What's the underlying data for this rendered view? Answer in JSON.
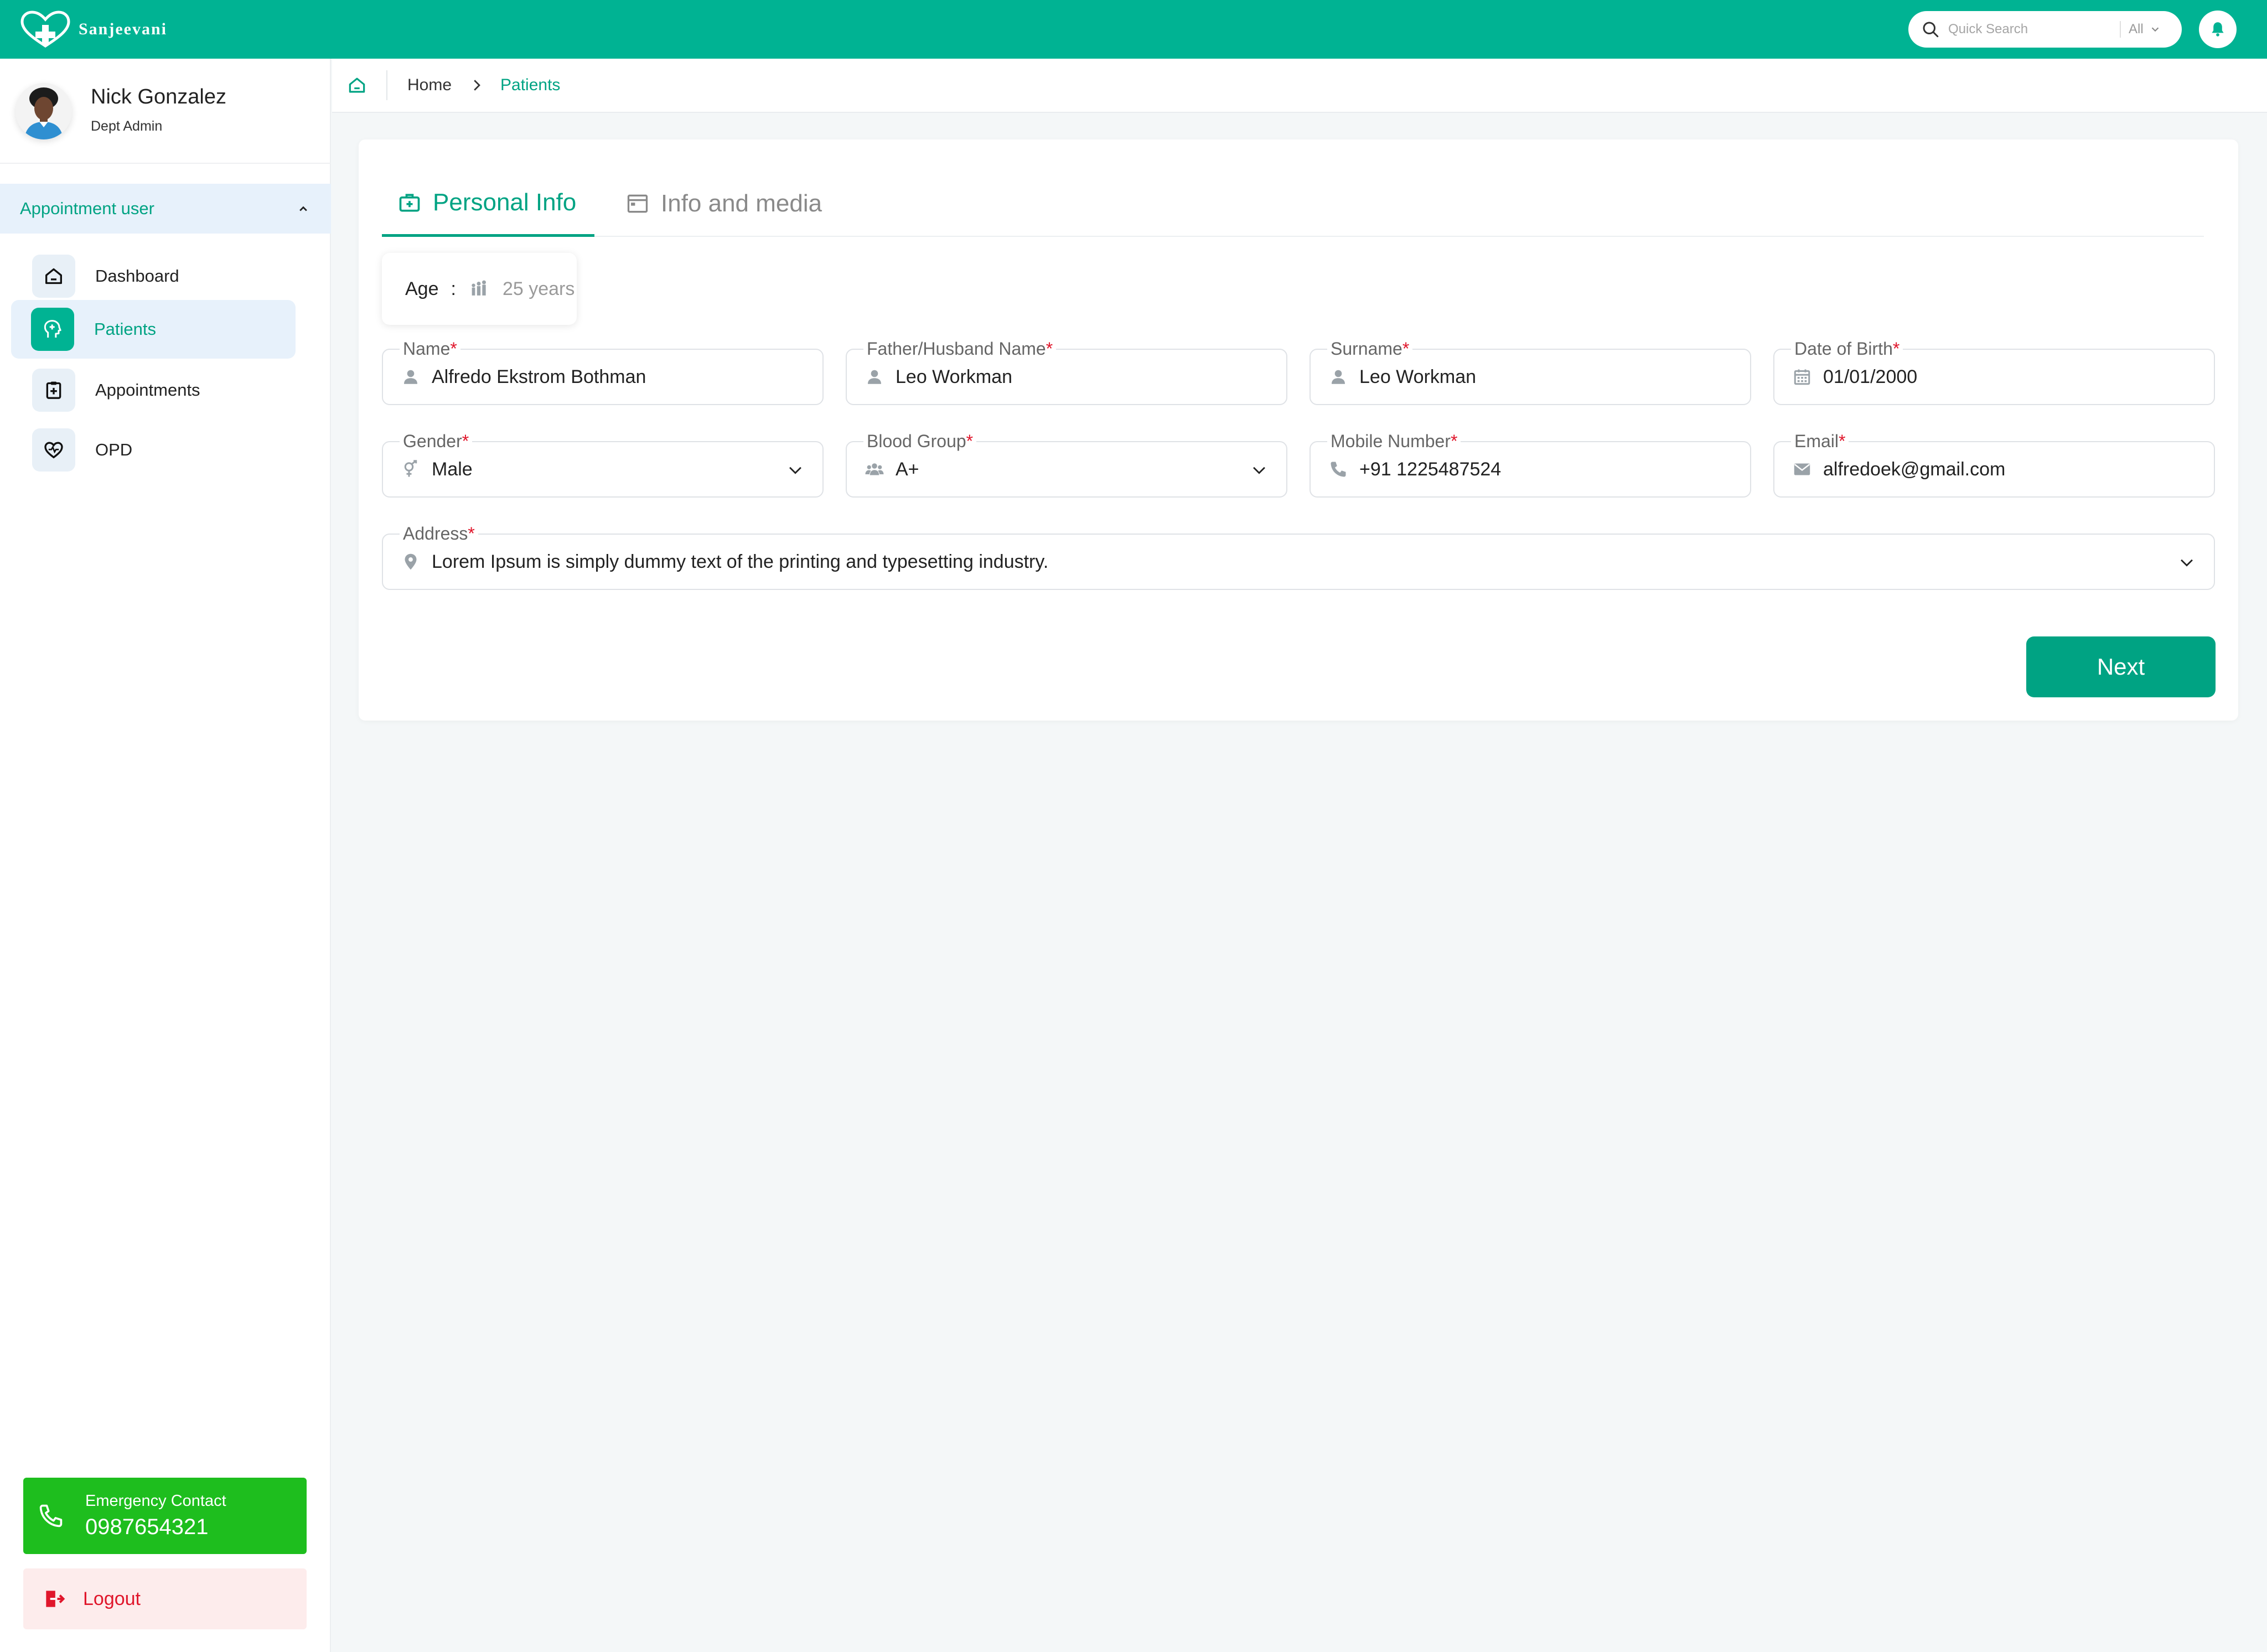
{
  "app": {
    "brand_name": "Sanjeevani"
  },
  "header": {
    "search": {
      "placeholder": "Quick Search",
      "scope": "All",
      "icon": "search-icon"
    },
    "notifications_icon": "bell-icon",
    "colors": {
      "primary": "#00b393",
      "accent": "#00a383"
    }
  },
  "user": {
    "name": "Nick Gonzalez",
    "role": "Dept Admin"
  },
  "sidebar": {
    "section_title": "Appointment user",
    "items": [
      {
        "label": "Dashboard",
        "icon": "home-icon",
        "active": false
      },
      {
        "label": "Patients",
        "icon": "patient-icon",
        "active": true
      },
      {
        "label": "Appointments",
        "icon": "clipboard-icon",
        "active": false
      },
      {
        "label": "OPD",
        "icon": "heart-pulse-icon",
        "active": false
      }
    ],
    "emergency": {
      "label": "Emergency Contact",
      "number": "0987654321",
      "color": "#1ebe1e"
    },
    "logout_label": "Logout"
  },
  "breadcrumb": {
    "home": "Home",
    "current": "Patients"
  },
  "tabs": [
    {
      "label": "Personal Info",
      "icon": "briefcase-medical-icon",
      "active": true
    },
    {
      "label": "Info and media",
      "icon": "media-window-icon",
      "active": false
    }
  ],
  "age": {
    "label": "Age",
    "separator": ":",
    "value": "25 years"
  },
  "form": {
    "name": {
      "label": "Name",
      "value": "Alfredo Ekstrom Bothman",
      "required": "*"
    },
    "father_husband_name": {
      "label": "Father/Husband Name",
      "value": "Leo Workman",
      "required": "*"
    },
    "surname": {
      "label": "Surname",
      "value": "Leo Workman",
      "required": "*"
    },
    "dob": {
      "label": "Date of Birth",
      "value": "01/01/2000",
      "required": "*"
    },
    "gender": {
      "label": "Gender",
      "value": "Male",
      "required": "*"
    },
    "blood_group": {
      "label": "Blood Group",
      "value": "A+",
      "required": "*"
    },
    "mobile": {
      "label": "Mobile Number",
      "value": "+91 1225487524",
      "required": "*"
    },
    "email": {
      "label": "Email",
      "value": "alfredoek@gmail.com",
      "required": "*"
    },
    "address": {
      "label": "Address",
      "value": "Lorem Ipsum is simply dummy text of the printing and typesetting industry.",
      "required": "*"
    }
  },
  "actions": {
    "next_label": "Next"
  }
}
